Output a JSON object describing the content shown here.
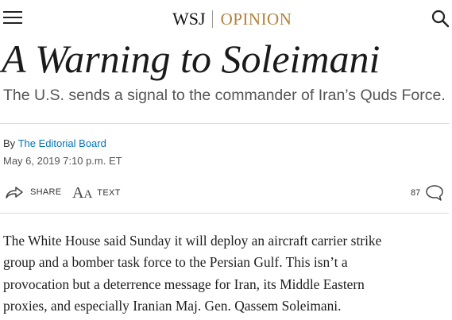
{
  "header": {
    "brand": "WSJ",
    "section": "OPINION",
    "accent_color": "#b3813a",
    "menu_icon": "hamburger-menu-icon",
    "search_icon": "search-icon"
  },
  "article": {
    "headline": "A Warning to Soleimani",
    "dek": "The U.S. sends a signal to the commander of Iran’s Quds Force.",
    "byline_prefix": "By",
    "author": "The Editorial Board",
    "date": "May 6, 2019 7:10 p.m. ET",
    "paragraph_lines": [
      "The White House said Sunday it will deploy an aircraft carrier strike",
      "group and a bomber task force to the Persian Gulf. This isn’t a",
      "provocation but a deterrence message for Iran, its Middle Eastern",
      "proxies, and especially Iranian Maj. Gen. Qassem Soleimani."
    ]
  },
  "toolbar": {
    "share_label": "SHARE",
    "text_label": "TEXT",
    "comment_count": "87",
    "share_icon": "share-arrow-icon",
    "text_icon": "text-size-icon",
    "comment_icon": "comment-bubble-icon"
  }
}
